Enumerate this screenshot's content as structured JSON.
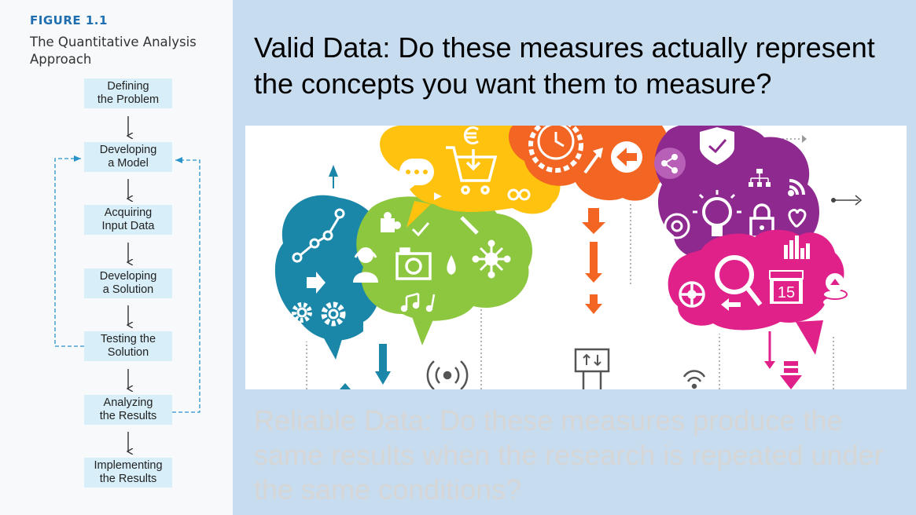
{
  "figure": {
    "label": "FIGURE 1.1",
    "title": "The Quantitative Analysis Approach",
    "steps": [
      "Defining\nthe Problem",
      "Developing\na Model",
      "Acquiring\nInput Data",
      "Developing\na Solution",
      "Testing the\nSolution",
      "Analyzing\nthe Results",
      "Implementing\nthe Results"
    ]
  },
  "slide": {
    "valid_heading": "Valid Data: Do these measures actually represent the concepts you want them to measure?",
    "reliable_text": "Reliable Data: Do these measures produce the same results when the research is repeated under the same conditions?"
  },
  "infographic": {
    "calendar_day": "15",
    "icons": [
      "share-icon",
      "euro-icon",
      "shopping-cart-icon",
      "chat-icon",
      "clock-icon",
      "gear-icon",
      "back-arrow-icon",
      "shield-check-icon",
      "network-icon",
      "wifi-icon",
      "lightbulb-icon",
      "at-icon",
      "padlock-icon",
      "heart-icon",
      "bar-chart-icon",
      "magnifier-icon",
      "calendar-icon",
      "upload-coins-icon",
      "camera-icon",
      "headset-user-icon",
      "puzzle-icon",
      "wrench-icon",
      "music-icon",
      "molecule-icon",
      "broadcast-icon"
    ],
    "colors": {
      "teal": "#1a86a8",
      "green": "#8dc63f",
      "yellow": "#ffc20e",
      "orange": "#f26522",
      "purple": "#8e2a8f",
      "magenta": "#e0218a",
      "arrow": "#1a86a8"
    }
  }
}
